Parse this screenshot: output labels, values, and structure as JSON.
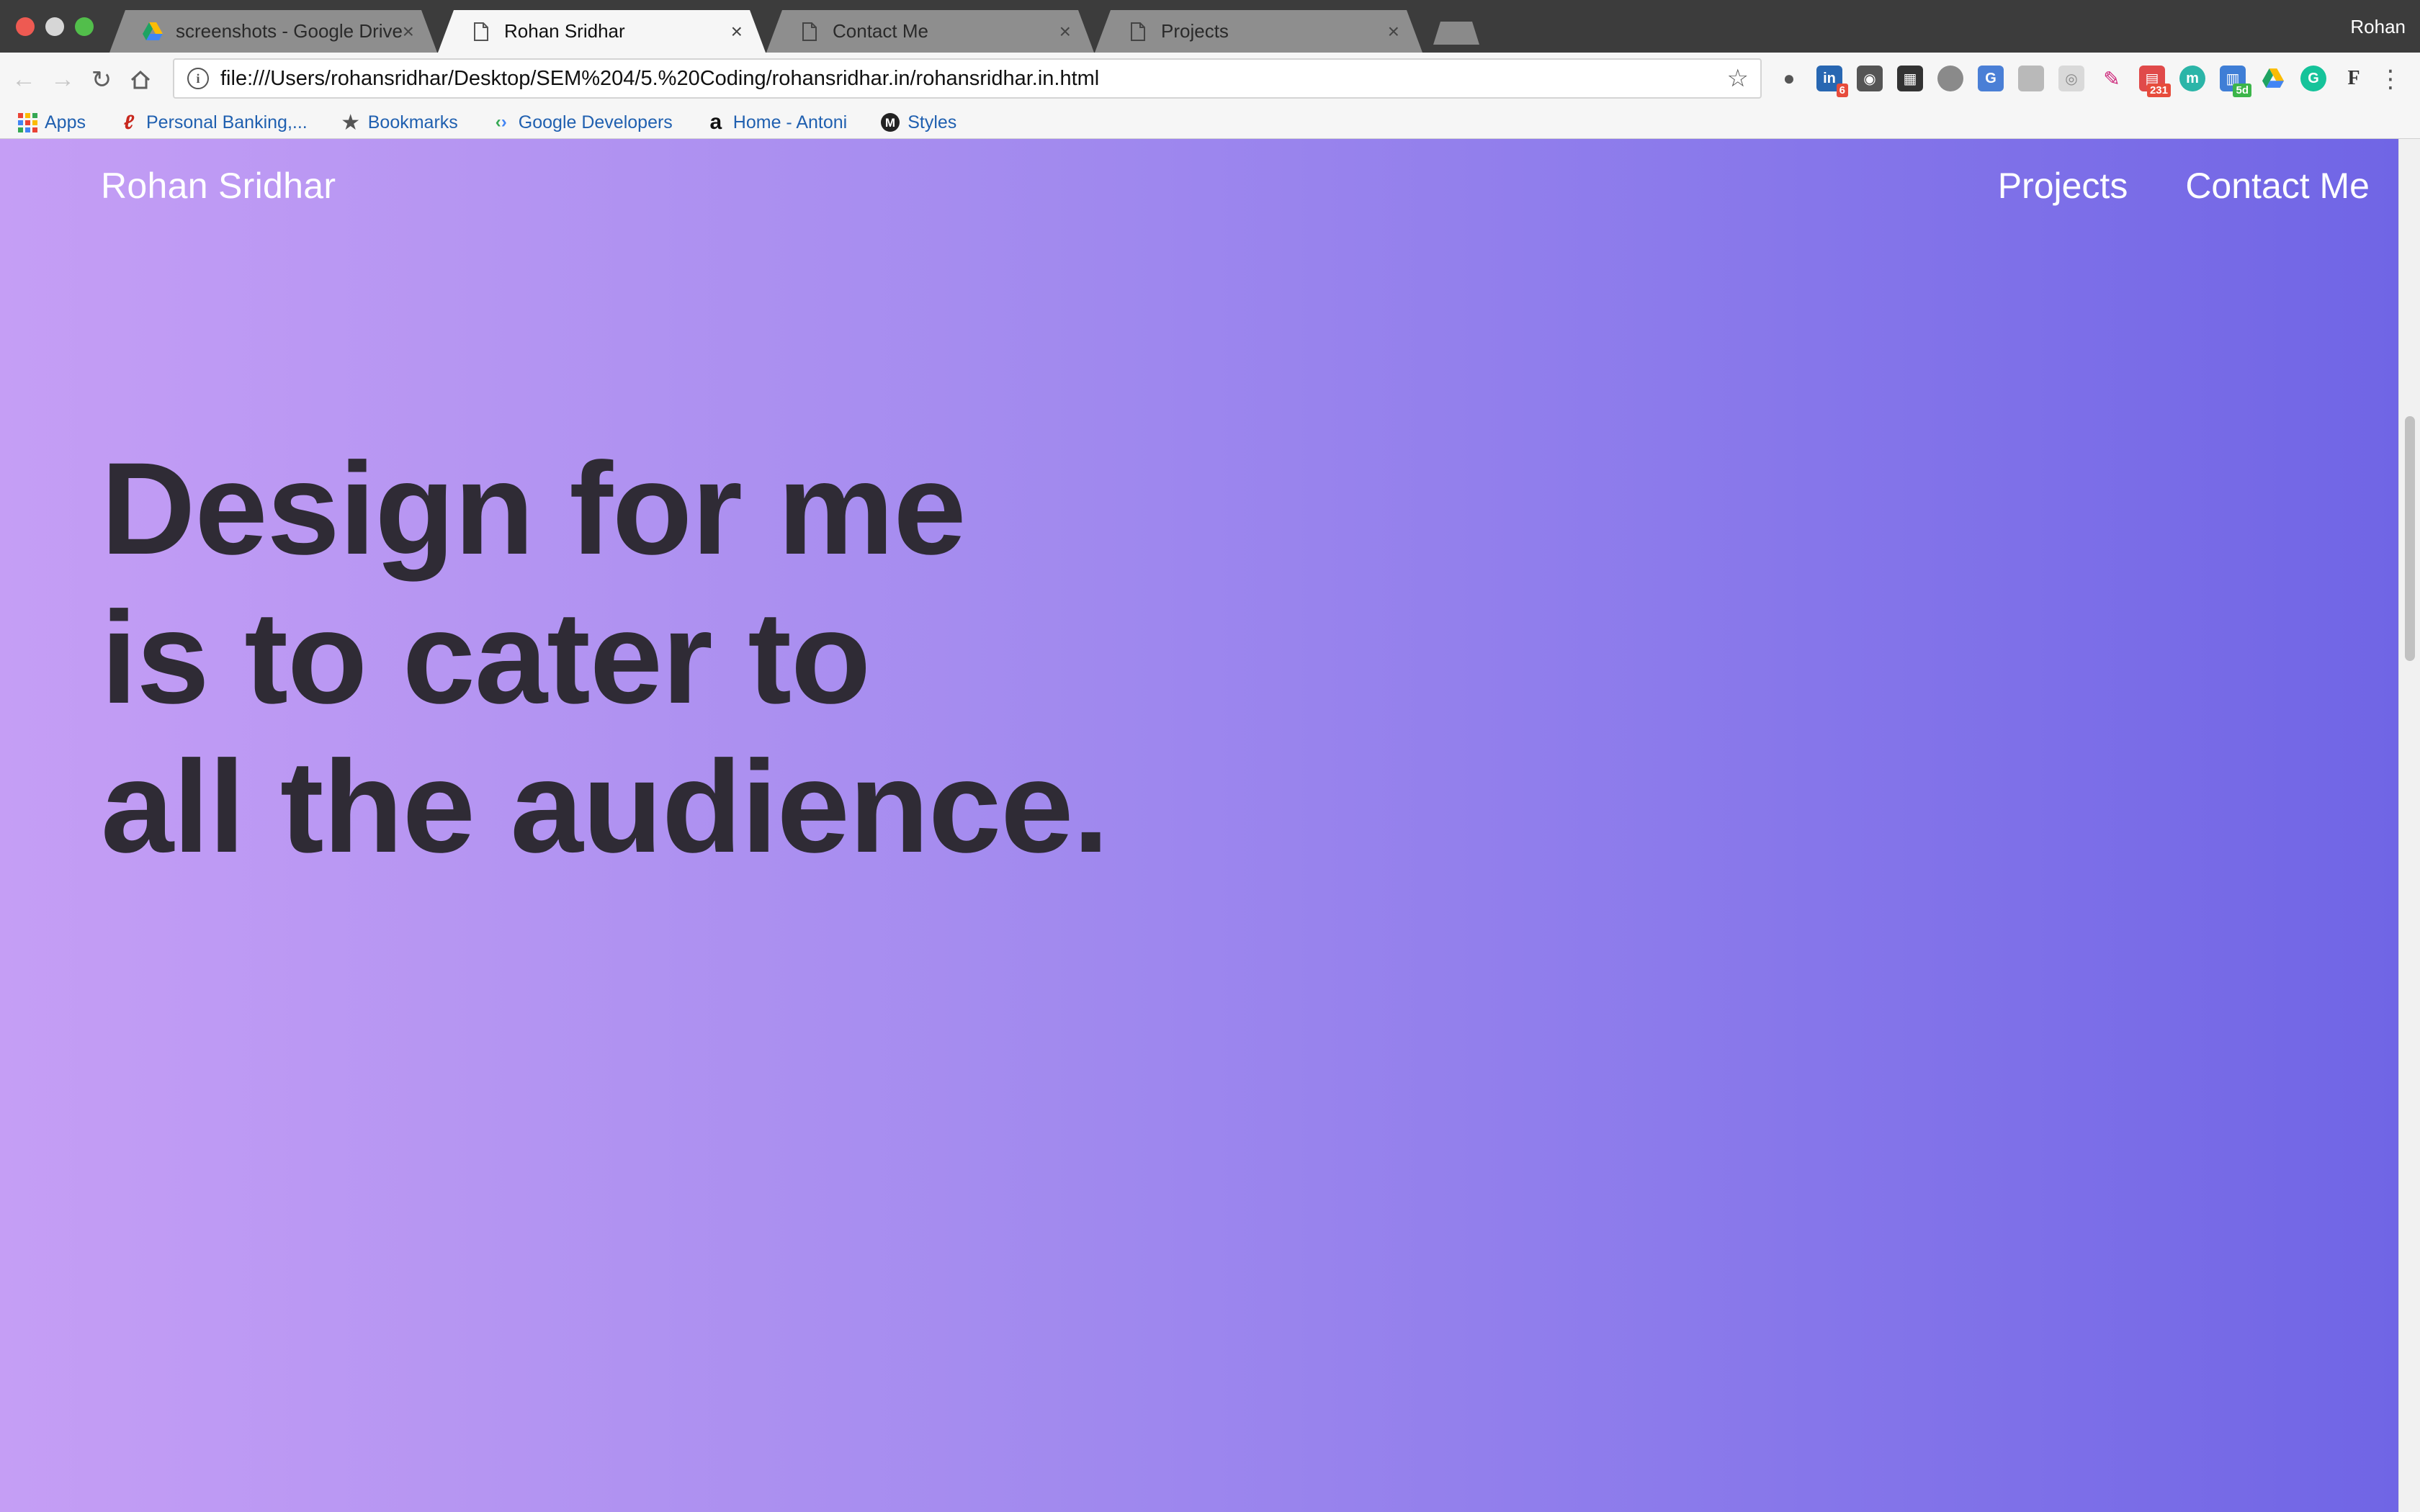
{
  "browser": {
    "tabs": [
      {
        "title": "screenshots - Google Drive",
        "icon": "google-drive-icon",
        "active": false
      },
      {
        "title": "Rohan Sridhar",
        "icon": "document-icon",
        "active": true
      },
      {
        "title": "Contact Me",
        "icon": "document-icon",
        "active": false
      },
      {
        "title": "Projects",
        "icon": "document-icon",
        "active": false
      }
    ],
    "profile_name": "Rohan",
    "url": "file:///Users/rohansridhar/Desktop/SEM%204/5.%20Coding/rohansridhar.in/rohansridhar.in.html",
    "extensions": [
      {
        "icon": "lightbulb-icon"
      },
      {
        "icon": "linkedin-icon",
        "badge": "6"
      },
      {
        "icon": "keep-icon"
      },
      {
        "icon": "film-icon"
      },
      {
        "icon": "chat-bubble-icon"
      },
      {
        "icon": "translate-icon"
      },
      {
        "icon": "wallet-icon"
      },
      {
        "icon": "camera-icon"
      },
      {
        "icon": "eyedropper-icon"
      },
      {
        "icon": "clapper-icon",
        "badge": "231"
      },
      {
        "icon": "mercury-icon"
      },
      {
        "icon": "calendar-icon",
        "badge": "5d"
      },
      {
        "icon": "google-drive-icon"
      },
      {
        "icon": "grammarly-icon"
      },
      {
        "icon": "font-icon"
      }
    ],
    "bookmarks": [
      {
        "label": "Apps",
        "icon": "apps-grid-icon"
      },
      {
        "label": "Personal Banking,...",
        "icon": "bank-icon"
      },
      {
        "label": "Bookmarks",
        "icon": "star-icon"
      },
      {
        "label": "Google Developers",
        "icon": "google-developers-icon"
      },
      {
        "label": "Home - Antoni",
        "icon": "amazon-icon"
      },
      {
        "label": "Styles",
        "icon": "medium-icon"
      }
    ]
  },
  "site": {
    "brand": "Rohan Sridhar",
    "nav": [
      {
        "label": "Projects"
      },
      {
        "label": "Contact Me"
      }
    ],
    "hero_lines": [
      "Design for me",
      "is to cater to",
      "all the audience."
    ],
    "colors": {
      "gradient_start": "#c59ef5",
      "gradient_end": "#7065e5",
      "hero_text": "#2f2b35",
      "nav_text": "#ffffff"
    }
  }
}
